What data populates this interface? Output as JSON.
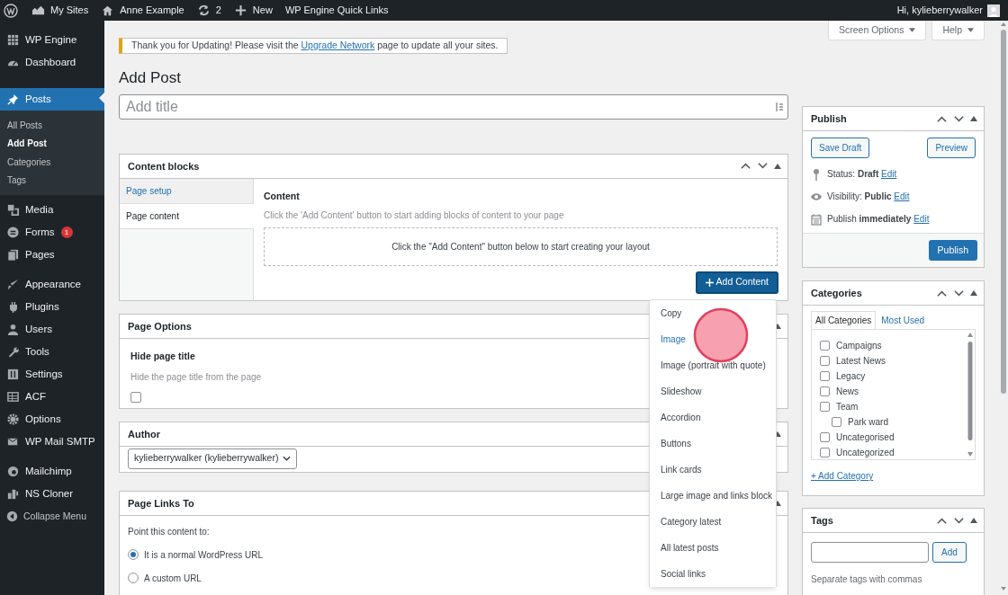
{
  "admin_bar": {
    "items": [
      {
        "label": "My Sites"
      },
      {
        "label": "Anne Example"
      },
      {
        "label": "2"
      },
      {
        "label": "New"
      },
      {
        "label": "WP Engine Quick Links"
      }
    ],
    "greeting": "Hi, kylieberrywalker"
  },
  "sidebar": {
    "groups": [
      [
        {
          "label": "WP Engine",
          "selected": false
        },
        {
          "label": "Dashboard",
          "selected": false
        }
      ],
      [
        {
          "label": "Posts",
          "selected": true,
          "children": [
            {
              "label": "All Posts",
              "selected": false
            },
            {
              "label": "Add Post",
              "selected": true
            },
            {
              "label": "Categories",
              "selected": false
            },
            {
              "label": "Tags",
              "selected": false
            }
          ]
        },
        {
          "label": "Media",
          "selected": false
        },
        {
          "label": "Forms",
          "selected": false,
          "badge": "1"
        },
        {
          "label": "Pages",
          "selected": false
        }
      ],
      [
        {
          "label": "Appearance",
          "selected": false
        },
        {
          "label": "Plugins",
          "selected": false
        },
        {
          "label": "Users",
          "selected": false
        },
        {
          "label": "Tools",
          "selected": false
        },
        {
          "label": "Settings",
          "selected": false
        },
        {
          "label": "ACF",
          "selected": false
        },
        {
          "label": "Options",
          "selected": false
        },
        {
          "label": "WP Mail SMTP",
          "selected": false
        }
      ],
      [
        {
          "label": "Mailchimp",
          "selected": false
        },
        {
          "label": "NS Cloner",
          "selected": false
        }
      ]
    ],
    "collapse": "Collapse Menu"
  },
  "screen_tabs": [
    "Screen Options",
    "Help"
  ],
  "notice": {
    "before": "Thank you for Updating! Please visit the",
    "link": "Upgrade Network",
    "after": "page to update all your sites."
  },
  "page_title": "Add Post",
  "title_field": {
    "placeholder": "Add title"
  },
  "content_blocks": {
    "title": "Content blocks",
    "tabs": [
      {
        "label": "Page setup",
        "selected": false
      },
      {
        "label": "Page content",
        "selected": true
      }
    ],
    "heading": "Content",
    "description": "Click the 'Add Content' button to start adding blocks of content to your page",
    "dropzone": "Click the \"Add Content\" button below to start creating your layout",
    "button": "Add Content",
    "menu": [
      {
        "label": "Copy",
        "selected": false
      },
      {
        "label": "Image",
        "selected": true
      },
      {
        "label": "Image (portrait with quote)",
        "selected": false
      },
      {
        "label": "Slideshow",
        "selected": false
      },
      {
        "label": "Accordion",
        "selected": false
      },
      {
        "label": "Buttons",
        "selected": false
      },
      {
        "label": "Link cards",
        "selected": false
      },
      {
        "label": "Large image and links block",
        "selected": false
      },
      {
        "label": "Category latest",
        "selected": false
      },
      {
        "label": "All latest posts",
        "selected": false
      },
      {
        "label": "Social links",
        "selected": false
      }
    ]
  },
  "page_options": {
    "title": "Page Options",
    "label": "Hide page title",
    "hint": "Hide the page title from the page",
    "checked": false
  },
  "author": {
    "title": "Author",
    "value": "kylieberrywalker (kylieberrywalker)"
  },
  "page_links": {
    "title": "Page Links To",
    "prompt": "Point this content to:",
    "options": [
      {
        "label": "It is a normal WordPress URL",
        "selected": true
      },
      {
        "label": "A custom URL",
        "selected": false
      }
    ]
  },
  "publish": {
    "title": "Publish",
    "save": "Save Draft",
    "preview": "Preview",
    "rows": [
      {
        "kind": "status",
        "label": "Status:",
        "value": "Draft",
        "link": "Edit"
      },
      {
        "kind": "visibility",
        "label": "Visibility:",
        "value": "Public",
        "link": "Edit"
      },
      {
        "kind": "schedule",
        "label": "Publish",
        "value": "immediately",
        "link": "Edit"
      }
    ],
    "button": "Publish"
  },
  "categories": {
    "title": "Categories",
    "tabs": [
      {
        "label": "All Categories",
        "selected": true
      },
      {
        "label": "Most Used",
        "selected": false
      }
    ],
    "items": [
      {
        "label": "Campaigns",
        "checked": false
      },
      {
        "label": "Latest News",
        "checked": false
      },
      {
        "label": "Legacy",
        "checked": false
      },
      {
        "label": "News",
        "checked": false
      },
      {
        "label": "Team",
        "checked": false,
        "children": [
          {
            "label": "Park ward",
            "checked": false
          }
        ]
      },
      {
        "label": "Uncategorised",
        "checked": false
      },
      {
        "label": "Uncategorized",
        "checked": false
      }
    ],
    "add_link": "+ Add Category"
  },
  "tags": {
    "title": "Tags",
    "button": "Add",
    "hint": "Separate tags with commas"
  }
}
